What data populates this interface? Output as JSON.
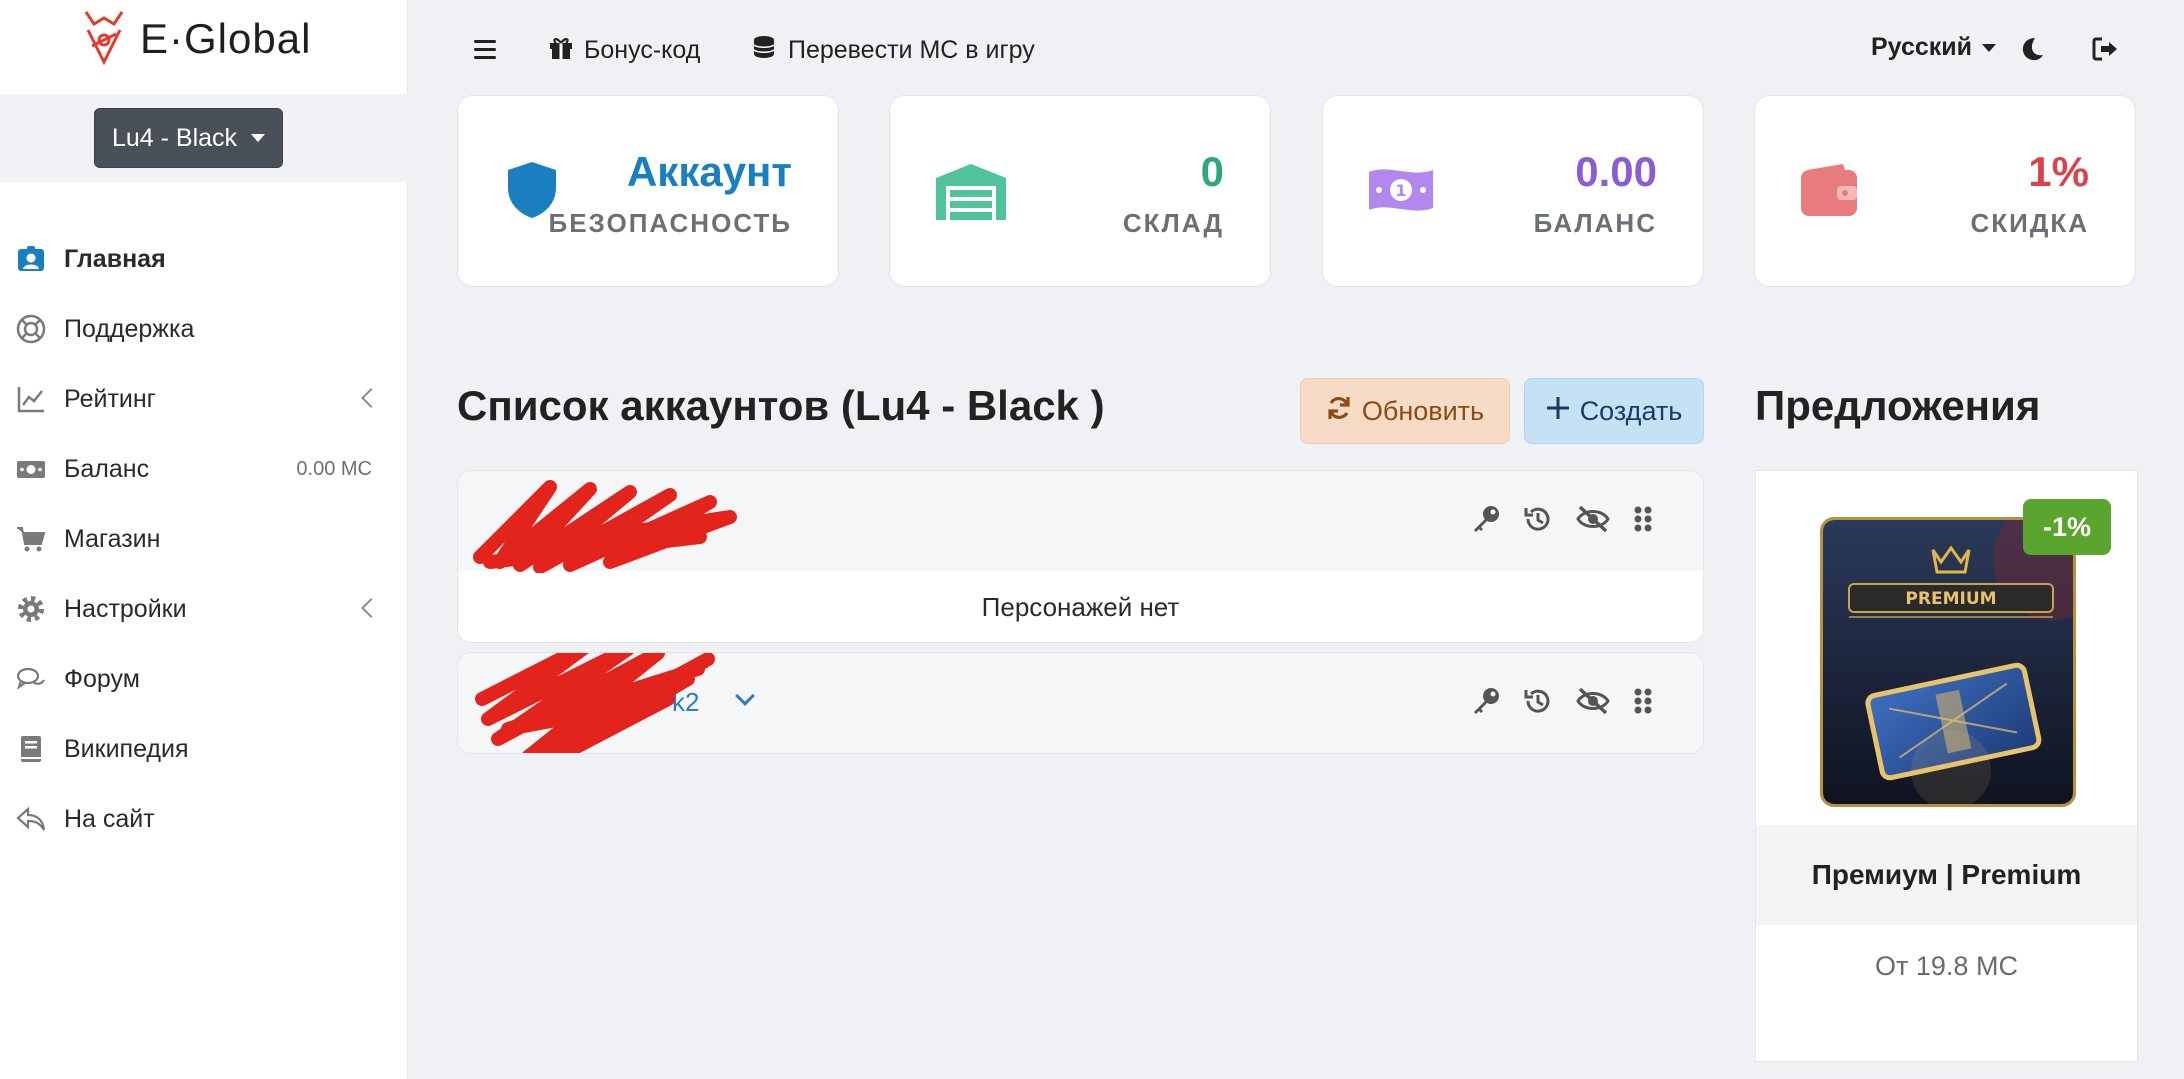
{
  "brand": {
    "logo_text": "E·Global"
  },
  "server_select": {
    "label": "Lu4 - Black"
  },
  "sidebar": {
    "items": [
      {
        "label": "Главная",
        "icon": "user-badge-icon",
        "active": true
      },
      {
        "label": "Поддержка",
        "icon": "lifebuoy-icon"
      },
      {
        "label": "Рейтинг",
        "icon": "chart-line-icon",
        "has_submenu": true
      },
      {
        "label": "Баланс",
        "icon": "money-icon",
        "side": "0.00 MC"
      },
      {
        "label": "Магазин",
        "icon": "cart-icon"
      },
      {
        "label": "Настройки",
        "icon": "gear-icon",
        "has_submenu": true
      },
      {
        "label": "Форум",
        "icon": "comments-icon"
      },
      {
        "label": "Википедия",
        "icon": "book-icon"
      },
      {
        "label": "На сайт",
        "icon": "reply-icon"
      }
    ]
  },
  "topbar": {
    "bonus_label": "Бонус-код",
    "transfer_label": "Перевести МС в игру",
    "language": "Русский"
  },
  "cards": [
    {
      "value": "Аккаунт",
      "label": "БЕЗОПАСНОСТЬ",
      "color": "#1a7fc1",
      "icon": "shield-icon"
    },
    {
      "value": "0",
      "label": "СКЛАД",
      "color": "#2ea77a",
      "icon": "warehouse-icon"
    },
    {
      "value": "0.00",
      "label": "БАЛАНС",
      "color": "#8a5cd6",
      "icon": "money-bill-icon"
    },
    {
      "value": "1%",
      "label": "СКИДКА",
      "color": "#d9434b",
      "icon": "wallet-icon"
    }
  ],
  "accounts": {
    "title": "Список аккаунтов (Lu4 - Black )",
    "refresh_label": "Обновить",
    "create_label": "Создать",
    "list": [
      {
        "name_visible": "",
        "characters_text": "Персонажей нет"
      },
      {
        "name_visible": "k2"
      }
    ]
  },
  "offers": {
    "title": "Предложения",
    "item": {
      "name": "Премиум | Premium",
      "price": "От 19.8 MC",
      "discount": "-1%",
      "image_label": "PREMIUM"
    }
  },
  "colors": {
    "sidebar_active_icon": "#1a7fc1",
    "discount_badge": "#5aa52d",
    "link": "#2b7cc4"
  }
}
